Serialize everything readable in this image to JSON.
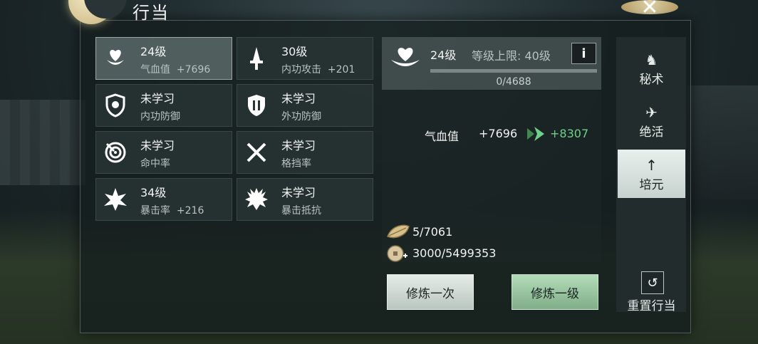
{
  "window": {
    "title": "行当",
    "close_glyph": "✕"
  },
  "skills": [
    {
      "level": "24级",
      "stat": "气血值",
      "value": "+7696",
      "icon": "lotus-icon"
    },
    {
      "level": "30级",
      "stat": "内功攻击",
      "value": "+201",
      "icon": "dagger-icon"
    },
    {
      "level": "未学习",
      "stat": "内功防御",
      "value": "",
      "icon": "inner-shield-icon"
    },
    {
      "level": "未学习",
      "stat": "外功防御",
      "value": "",
      "icon": "outer-shield-icon"
    },
    {
      "level": "未学习",
      "stat": "命中率",
      "value": "",
      "icon": "target-icon"
    },
    {
      "level": "未学习",
      "stat": "格挡率",
      "value": "",
      "icon": "crossed-swords-icon"
    },
    {
      "level": "34级",
      "stat": "暴击率",
      "value": "+216",
      "icon": "burst-icon"
    },
    {
      "level": "未学习",
      "stat": "暴击抵抗",
      "value": "",
      "icon": "spiked-shield-icon"
    }
  ],
  "detail": {
    "level": "24级",
    "max_label": "等级上限: 40级",
    "info_glyph": "i",
    "progress_text": "0/4688",
    "progress_fraction": 0.0,
    "stat_name": "气血值",
    "stat_value": "+7696",
    "stat_next": "+8307",
    "cost1": "5/7061",
    "cost2": "3000/5499353",
    "btn_once": "修炼一次",
    "btn_level": "修炼一级"
  },
  "tabs": [
    {
      "label": "秘术",
      "glyph": "♞"
    },
    {
      "label": "绝活",
      "glyph": "✈"
    },
    {
      "label": "培元",
      "glyph": "↑"
    }
  ],
  "reset": {
    "label": "重置行当",
    "glyph": "↺"
  },
  "colors": {
    "accent_green": "#6fd08a",
    "active_tab": "#e8efec"
  }
}
